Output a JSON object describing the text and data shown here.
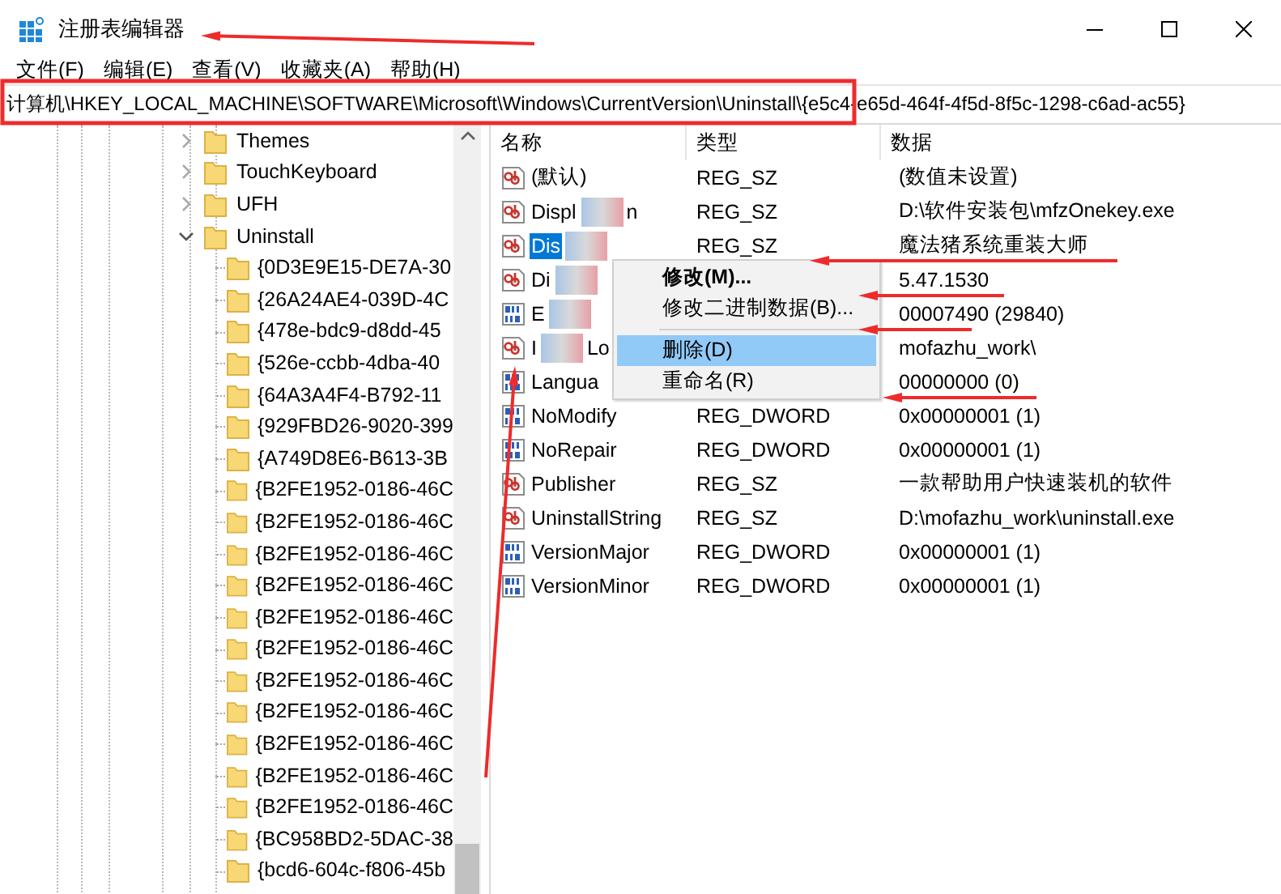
{
  "window": {
    "title": "注册表编辑器"
  },
  "menu_bar": [
    "文件(F)",
    "编辑(E)",
    "查看(V)",
    "收藏夹(A)",
    "帮助(H)"
  ],
  "address_bar": {
    "value": "计算机\\HKEY_LOCAL_MACHINE\\SOFTWARE\\Microsoft\\Windows\\CurrentVersion\\Uninstall\\{e5c4-e65d-464f-4f5d-8f5c-1298-c6ad-ac55}"
  },
  "tree": [
    {
      "label": "Themes",
      "expanded": false
    },
    {
      "label": "TouchKeyboard",
      "expanded": false
    },
    {
      "label": "UFH",
      "expanded": false
    },
    {
      "label": "Uninstall",
      "expanded": true,
      "children": [
        {
          "label": "{0D3E9E15-DE7A-30"
        },
        {
          "label": "{26A24AE4-039D-4C"
        },
        {
          "label": "{478e-bdc9-d8dd-45"
        },
        {
          "label": "{526e-ccbb-4dba-40"
        },
        {
          "label": "{64A3A4F4-B792-11"
        },
        {
          "label": "{929FBD26-9020-399"
        },
        {
          "label": "{A749D8E6-B613-3B"
        },
        {
          "label": "{B2FE1952-0186-46C"
        },
        {
          "label": "{B2FE1952-0186-46C"
        },
        {
          "label": "{B2FE1952-0186-46C"
        },
        {
          "label": "{B2FE1952-0186-46C"
        },
        {
          "label": "{B2FE1952-0186-46C"
        },
        {
          "label": "{B2FE1952-0186-46C"
        },
        {
          "label": "{B2FE1952-0186-46C"
        },
        {
          "label": "{B2FE1952-0186-46C"
        },
        {
          "label": "{B2FE1952-0186-46C"
        },
        {
          "label": "{B2FE1952-0186-46C"
        },
        {
          "label": "{B2FE1952-0186-46C"
        },
        {
          "label": "{BC958BD2-5DAC-38"
        },
        {
          "label": "{bcd6-604c-f806-45b"
        }
      ]
    }
  ],
  "values": {
    "columns": [
      "名称",
      "类型",
      "数据"
    ],
    "rows": [
      {
        "kind": "string",
        "name": "(默认)",
        "type": "REG_SZ",
        "data": "(数值未设置)",
        "selected": false,
        "redacted": false
      },
      {
        "kind": "string",
        "name": "Displ",
        "name_tail": "n",
        "type": "REG_SZ",
        "data": "D:\\软件安装包\\mfzOnekey.exe",
        "selected": false,
        "redacted": true
      },
      {
        "kind": "string",
        "name": "Dis",
        "type": "REG_SZ",
        "data": "魔法猪系统重装大师",
        "selected": true,
        "redacted": true
      },
      {
        "kind": "string",
        "name": "Di",
        "data": "5.47.1530",
        "selected": false,
        "redacted": true
      },
      {
        "kind": "binary",
        "name": "E",
        "data": "00007490 (29840)",
        "selected": false,
        "redacted": true
      },
      {
        "kind": "string",
        "name": "I",
        "name_tail": "Lo",
        "data": "mofazhu_work\\",
        "selected": false,
        "redacted": true
      },
      {
        "kind": "binary",
        "name": "Langua",
        "data": "00000000 (0)",
        "selected": false,
        "redacted": false
      },
      {
        "kind": "binary",
        "name": "NoModify",
        "type": "REG_DWORD",
        "data": "0x00000001 (1)",
        "selected": false,
        "redacted": false
      },
      {
        "kind": "binary",
        "name": "NoRepair",
        "type": "REG_DWORD",
        "data": "0x00000001 (1)",
        "selected": false,
        "redacted": false
      },
      {
        "kind": "string",
        "name": "Publisher",
        "type": "REG_SZ",
        "data": "一款帮助用户快速装机的软件",
        "selected": false,
        "redacted": false
      },
      {
        "kind": "string",
        "name": "UninstallString",
        "type": "REG_SZ",
        "data": "D:\\mofazhu_work\\uninstall.exe",
        "selected": false,
        "redacted": false
      },
      {
        "kind": "binary",
        "name": "VersionMajor",
        "type": "REG_DWORD",
        "data": "0x00000001 (1)",
        "selected": false,
        "redacted": false
      },
      {
        "kind": "binary",
        "name": "VersionMinor",
        "type": "REG_DWORD",
        "data": "0x00000001 (1)",
        "selected": false,
        "redacted": false
      }
    ]
  },
  "context_menu": [
    {
      "kind": "item",
      "label": "修改(M)...",
      "bold": true,
      "selected": false
    },
    {
      "kind": "item",
      "label": "修改二进制数据(B)...",
      "bold": false,
      "selected": false
    },
    {
      "kind": "separator"
    },
    {
      "kind": "item",
      "label": "删除(D)",
      "bold": false,
      "selected": true
    },
    {
      "kind": "item",
      "label": "重命名(R)",
      "bold": false,
      "selected": false
    }
  ]
}
